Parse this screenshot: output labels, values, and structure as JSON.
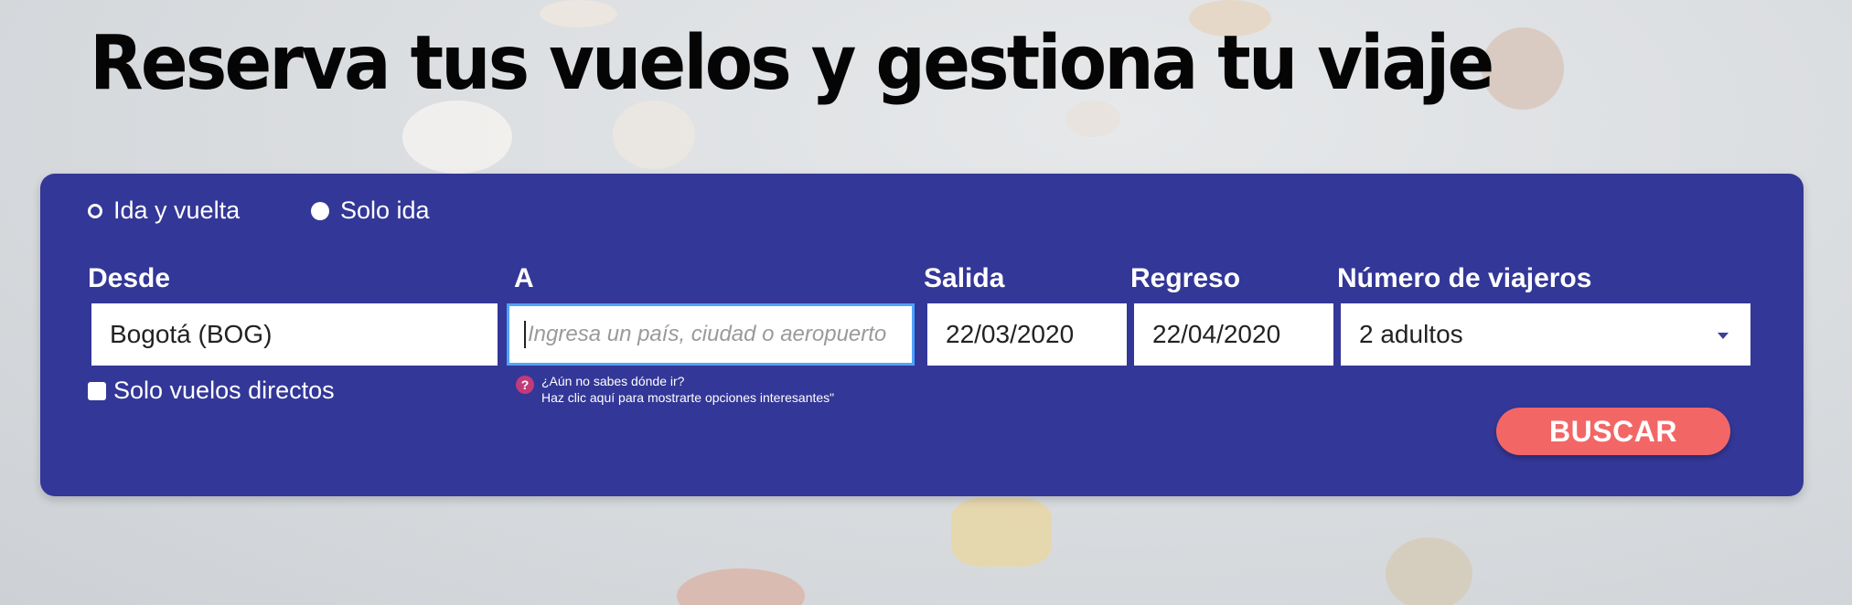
{
  "page": {
    "title": "Reserva tus vuelos y gestiona tu viaje"
  },
  "trip_type": {
    "options": [
      "Ida y vuelta",
      "Solo ida"
    ]
  },
  "search": {
    "from_label": "Desde",
    "from_value": "Bogotá (BOG)",
    "to_label": "A",
    "to_placeholder": "Ingresa un país, ciudad o aeropuerto",
    "departure_label": "Salida",
    "departure_value": "22/03/2020",
    "return_label": "Regreso",
    "return_value": "22/04/2020",
    "travelers_label": "Número de viajeros",
    "travelers_value": "2 adultos",
    "direct_only_label": "Solo vuelos directos",
    "hint_line1": "¿Aún no sabes dónde ir?",
    "hint_line2": "Haz clic aquí para mostrarte opciones interesantes\"",
    "submit_label": "BUSCAR"
  },
  "colors": {
    "panel": "#333797",
    "button": "#f26766",
    "focus_border": "#4fa3ff"
  }
}
